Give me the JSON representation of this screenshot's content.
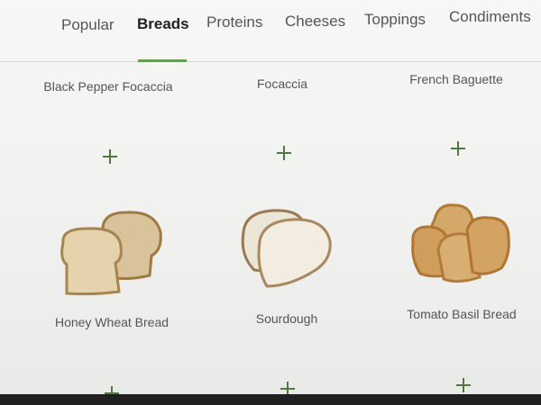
{
  "tabs": [
    {
      "label": "Popular"
    },
    {
      "label": "Breads"
    },
    {
      "label": "Proteins"
    },
    {
      "label": "Cheeses"
    },
    {
      "label": "Toppings"
    },
    {
      "label": "Condiments"
    }
  ],
  "active_tab": "Breads",
  "accent_color": "#6a9a55",
  "add_icon": "plus-icon",
  "items": [
    {
      "name": "Black Pepper Focaccia"
    },
    {
      "name": "Focaccia"
    },
    {
      "name": "French Baguette"
    },
    {
      "name": "Honey Wheat Bread"
    },
    {
      "name": "Sourdough"
    },
    {
      "name": "Tomato Basil Bread"
    }
  ]
}
